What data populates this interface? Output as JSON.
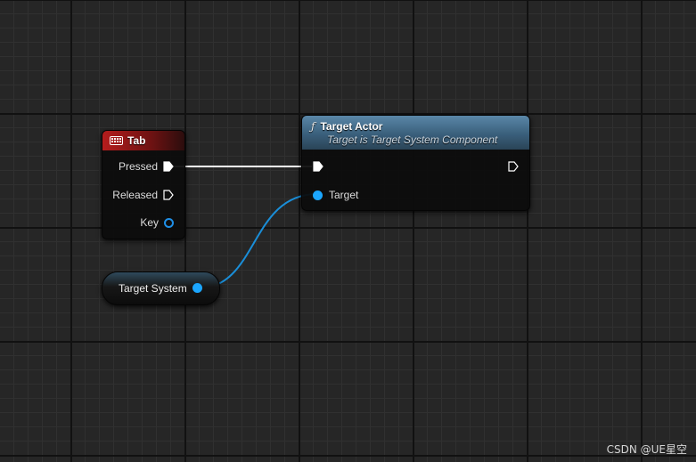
{
  "event_node": {
    "title": "Tab",
    "pins": {
      "pressed": "Pressed",
      "released": "Released",
      "key": "Key"
    }
  },
  "function_node": {
    "title": "Target Actor",
    "subtitle": "Target is Target System Component",
    "pins": {
      "target": "Target"
    }
  },
  "variable_node": {
    "label": "Target System"
  },
  "colors": {
    "event_header": "#b51d1d",
    "function_header": "#4a7594",
    "object_pin": "#1ba6ff",
    "exec_wire": "#ffffff",
    "object_wire": "#1a8ed8"
  },
  "icons": {
    "event": "keyboard-icon",
    "function": "function-icon"
  },
  "watermark": "CSDN @UE星空"
}
